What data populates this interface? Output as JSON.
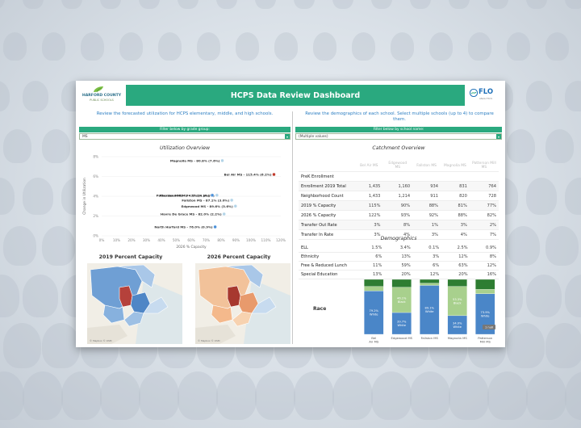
{
  "header": {
    "title": "HCPS Data Review Dashboard",
    "left_logo": {
      "name": "HARFORD COUNTY",
      "sub": "PUBLIC SCHOOLS"
    },
    "right_logo": {
      "name": "FLO",
      "sub": "ANALYTICS"
    }
  },
  "left_pane": {
    "instruction": "Review the forecasted utilization for HCPS elementary, middle, and high schools.",
    "filter_label": "Filter below by grade group:",
    "filter_value": "MS",
    "chart_title": "Utilization Overview",
    "map_titles": [
      "2019 Percent Capacity",
      "2026 Percent Capacity"
    ],
    "map_credit": "© Mapbox © OSM"
  },
  "right_pane": {
    "instruction": "Review the demographics of each school. Select multiple schools (up to 4) to compare them.",
    "filter_label": "Filter below by school name:",
    "filter_value": "(Multiple values)",
    "catchment_title": "Catchment Overview",
    "demographics_title": "Demographics",
    "race_label": "Race",
    "tooltip_badge": "1 null"
  },
  "chart_data": [
    {
      "type": "scatter",
      "title": "Utilization Overview",
      "xlabel": "2026 % Capacity",
      "ylabel": "Change in Utilization",
      "xlim": [
        0,
        120
      ],
      "ylim": [
        0,
        8
      ],
      "xticks": [
        "0%",
        "10%",
        "20%",
        "30%",
        "40%",
        "50%",
        "60%",
        "70%",
        "80%",
        "90%",
        "100%",
        "110%",
        "120%"
      ],
      "yticks": [
        "0%",
        "2%",
        "4%",
        "6%",
        "8%"
      ],
      "points": [
        {
          "label": "Magnolia MS - 80.8% (7.6%)",
          "x": 80.8,
          "y": 7.6,
          "color": "#b3d4e8"
        },
        {
          "label": "Bel Air MS - 115.4% (6.2%)",
          "x": 115.4,
          "y": 6.2,
          "color": "#c0392b"
        },
        {
          "label": "Patterson Mill MS - 77.2% (4.1%)",
          "x": 77.2,
          "y": 4.1,
          "color": "#b3d4e8"
        },
        {
          "label": "Fallston MS - 87.1% (3.0%)",
          "x": 87.1,
          "y": 3.6,
          "color": "#b3d4e8"
        },
        {
          "label": "Aberdeen MS - 74.1% (4.1%)",
          "x": 74.1,
          "y": 4.1,
          "color": "#4a90d9"
        },
        {
          "label": "Edgewood MS - 89.6% (3.6%)",
          "x": 89.6,
          "y": 3.0,
          "color": "#b3d4e8"
        },
        {
          "label": "Havre De Grace MS - 82.0% (2.2%)",
          "x": 82.0,
          "y": 2.2,
          "color": "#b3d4e8"
        },
        {
          "label": "North Harford MS - 76.0% (0.9%)",
          "x": 76.0,
          "y": 0.9,
          "color": "#4a90d9"
        }
      ]
    },
    {
      "type": "table",
      "title": "Catchment Overview",
      "columns": [
        "Bel Air MS",
        "Edgewood MS",
        "Fallston MS",
        "Magnolia MS",
        "Patterson Mill MS"
      ],
      "rows": [
        {
          "label": "PreK Enrollment",
          "values": [
            "",
            "",
            "",
            "",
            ""
          ]
        },
        {
          "label": "Enrollment 2019 Total",
          "values": [
            "1,435",
            "1,160",
            "934",
            "831",
            "764"
          ]
        },
        {
          "label": "Neighborhood Count",
          "values": [
            "1,433",
            "1,214",
            "911",
            "820",
            "728"
          ]
        },
        {
          "label": "2019 % Capacity",
          "values": [
            "115%",
            "90%",
            "88%",
            "81%",
            "77%"
          ]
        },
        {
          "label": "2026 % Capacity",
          "values": [
            "122%",
            "93%",
            "92%",
            "88%",
            "82%"
          ]
        },
        {
          "label": "Transfer Out Rate",
          "values": [
            "3%",
            "8%",
            "1%",
            "3%",
            "2%"
          ]
        },
        {
          "label": "Transfer In Rate",
          "values": [
            "3%",
            "4%",
            "3%",
            "4%",
            "7%"
          ]
        }
      ]
    },
    {
      "type": "table",
      "title": "Demographics",
      "rows": [
        {
          "label": "ELL",
          "values": [
            "1.5%",
            "3.4%",
            "0.1%",
            "2.5%",
            "0.9%"
          ]
        },
        {
          "label": "Ethnicity",
          "values": [
            "6%",
            "13%",
            "3%",
            "12%",
            "8%"
          ]
        },
        {
          "label": "Free & Reduced Lunch",
          "values": [
            "11%",
            "59%",
            "6%",
            "63%",
            "12%"
          ]
        },
        {
          "label": "Special Education",
          "values": [
            "13%",
            "20%",
            "12%",
            "20%",
            "16%"
          ]
        }
      ]
    },
    {
      "type": "bar",
      "title": "Race",
      "categories": [
        "Bel Air MS",
        "Edgewood MS",
        "Fallston MS",
        "Magnolia MS",
        "Patterson Mill MS"
      ],
      "series": [
        {
          "name": "White",
          "values": [
            79.2,
            39.7,
            89.1,
            34.0,
            73.9
          ],
          "labels": [
            "79.2% White",
            "39.7% White",
            "89.1% White",
            "34.0% White",
            "73.9% White"
          ],
          "color": "#4a86c8"
        },
        {
          "name": "Black",
          "values": [
            8,
            46.1,
            4,
            53.3,
            8
          ],
          "labels": [
            "",
            "46.1% Black",
            "",
            "53.3% Black",
            ""
          ],
          "color": "#a8d08d"
        },
        {
          "name": "Other",
          "values": [
            12.8,
            14.2,
            6.9,
            12.7,
            18.1
          ],
          "labels": [
            "",
            "",
            "",
            "",
            ""
          ],
          "color": "#2e7d32"
        }
      ]
    }
  ]
}
